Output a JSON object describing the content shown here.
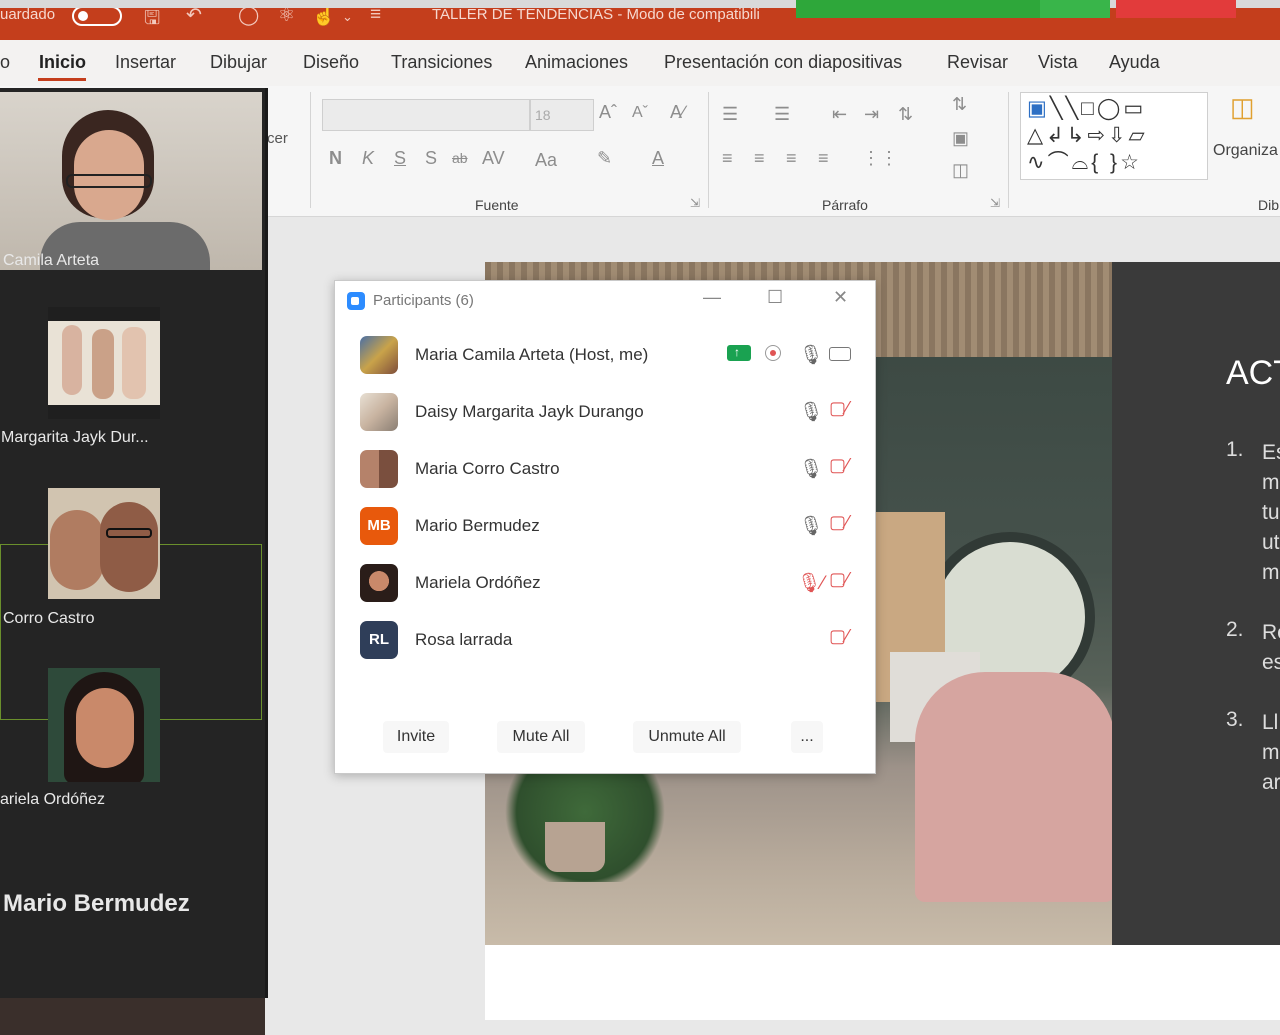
{
  "titlebar": {
    "autosave_text": "uardado",
    "doc_title": "TALLER DE TENDENCIAS  -  Modo de compatibili"
  },
  "menu": {
    "items": [
      {
        "label": "o"
      },
      {
        "label": "Inicio"
      },
      {
        "label": "Insertar"
      },
      {
        "label": "Dibujar"
      },
      {
        "label": "Diseño"
      },
      {
        "label": "Transiciones"
      },
      {
        "label": "Animaciones"
      },
      {
        "label": "Presentación con diapositivas"
      },
      {
        "label": "Revisar"
      },
      {
        "label": "Vista"
      },
      {
        "label": "Ayuda"
      }
    ]
  },
  "ribbon": {
    "clipboard_partial": "cer",
    "font_size": "18",
    "group_font": "Fuente",
    "group_paragraph": "Párrafo",
    "organize_label": "Organiza",
    "drawing_partial": "Dib",
    "bold": "N",
    "italic": "K",
    "underline": "S",
    "shadow": "S",
    "strike": "ab",
    "spacing": "AV",
    "case": "Aa"
  },
  "video_strip": {
    "tiles": [
      {
        "name": "Camila Arteta"
      },
      {
        "name": "Margarita Jayk Dur..."
      },
      {
        "name": "Corro Castro"
      },
      {
        "name": "ariela Ordóñez"
      },
      {
        "name": "Mario Bermudez"
      }
    ]
  },
  "participants": {
    "title": "Participants (6)",
    "rows": [
      {
        "name": "Maria Camila Arteta (Host, me)",
        "initials": "",
        "mic": "on",
        "video": "on"
      },
      {
        "name": "Daisy Margarita Jayk Durango",
        "initials": "",
        "mic": "on",
        "video": "off"
      },
      {
        "name": "Maria Corro Castro",
        "initials": "",
        "mic": "on",
        "video": "off"
      },
      {
        "name": "Mario Bermudez",
        "initials": "MB",
        "mic": "on",
        "video": "off"
      },
      {
        "name": "Mariela Ordóñez",
        "initials": "",
        "mic": "off",
        "video": "off"
      },
      {
        "name": "Rosa larrada",
        "initials": "RL",
        "mic": "none",
        "video": "off"
      }
    ],
    "buttons": {
      "invite": "Invite",
      "mute_all": "Mute All",
      "unmute_all": "Unmute All",
      "more": "..."
    },
    "colors": {
      "mb": "#e8590c",
      "rl": "#2f3e59",
      "share": "#1aa251",
      "muted": "#e05555"
    }
  },
  "slide": {
    "heading_partial": "ACT",
    "list": [
      {
        "num": "1.",
        "lines": [
          "Es",
          "m",
          "tu",
          "ut",
          "m"
        ]
      },
      {
        "num": "2.",
        "lines": [
          "Re",
          "es"
        ]
      },
      {
        "num": "3.",
        "lines": [
          "Ll",
          "m",
          "ar"
        ]
      }
    ]
  }
}
